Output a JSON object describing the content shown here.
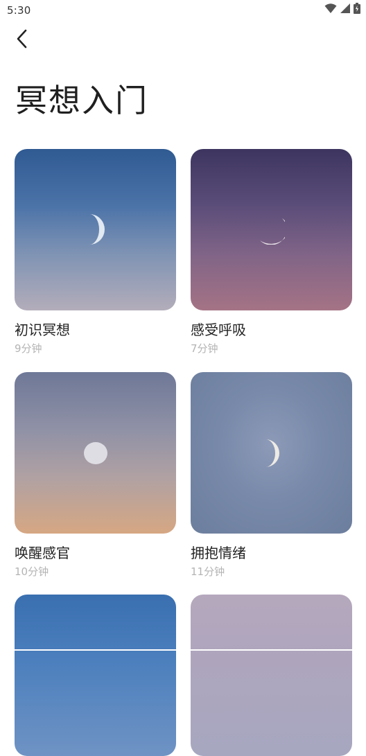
{
  "status_bar": {
    "time": "5:30",
    "icons": [
      "wifi-icon",
      "cellular-signal-icon",
      "battery-icon"
    ]
  },
  "header": {
    "back_icon": "chevron-left-icon",
    "title": "冥想入门"
  },
  "colors": {
    "title_text": "#1f1f1f",
    "card_title_text": "#222222",
    "duration_text": "#b4b4b4",
    "background": "#ffffff"
  },
  "cards": [
    {
      "title": "初识冥想",
      "duration": "9分钟"
    },
    {
      "title": "感受呼吸",
      "duration": "7分钟"
    },
    {
      "title": "唤醒感官",
      "duration": "10分钟"
    },
    {
      "title": "拥抱情绪",
      "duration": "11分钟"
    },
    {
      "title": "",
      "duration": ""
    },
    {
      "title": "",
      "duration": ""
    }
  ]
}
